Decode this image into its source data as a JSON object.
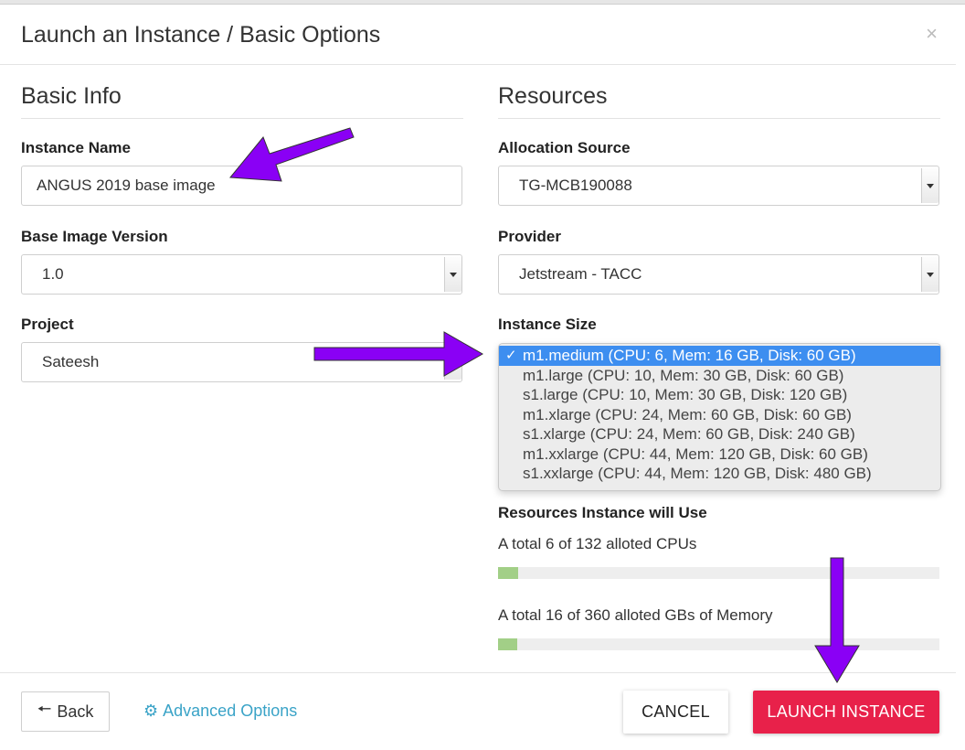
{
  "modal": {
    "title": "Launch an Instance / Basic Options",
    "close_icon": "×"
  },
  "basic_info": {
    "heading": "Basic Info",
    "instance_name": {
      "label": "Instance Name",
      "value": "ANGUS 2019 base image"
    },
    "base_image_version": {
      "label": "Base Image Version",
      "value": "1.0"
    },
    "project": {
      "label": "Project",
      "value": "Sateesh"
    }
  },
  "resources": {
    "heading": "Resources",
    "allocation_source": {
      "label": "Allocation Source",
      "value": "TG-MCB190088"
    },
    "provider": {
      "label": "Provider",
      "value": "Jetstream - TACC"
    },
    "instance_size": {
      "label": "Instance Size",
      "selected_check": "✓",
      "options": [
        "m1.medium (CPU: 6, Mem: 16 GB, Disk: 60 GB)",
        "m1.large (CPU: 10, Mem: 30 GB, Disk: 60 GB)",
        "s1.large (CPU: 10, Mem: 30 GB, Disk: 120 GB)",
        "m1.xlarge (CPU: 24, Mem: 60 GB, Disk: 60 GB)",
        "s1.xlarge (CPU: 24, Mem: 60 GB, Disk: 240 GB)",
        "m1.xxlarge (CPU: 44, Mem: 120 GB, Disk: 60 GB)",
        "s1.xxlarge (CPU: 44, Mem: 120 GB, Disk: 480 GB)"
      ]
    },
    "usage": {
      "heading": "Resources Instance will Use",
      "cpu_text": "A total 6 of 132 alloted CPUs",
      "cpu_fraction": 0.0455,
      "memory_text": "A total 16 of 360 alloted GBs of Memory",
      "memory_fraction": 0.0444
    }
  },
  "footer": {
    "back_label": "Back",
    "back_icon": "arrow-left-icon",
    "advanced_label": "Advanced Options",
    "advanced_icon": "gear-icon",
    "cancel_label": "CANCEL",
    "launch_label": "LAUNCH INSTANCE"
  },
  "colors": {
    "accent_link": "#3aa3c7",
    "launch_button": "#e8214a",
    "selected_option": "#3d8ef0",
    "progress_fill": "#a2cf87",
    "annotation_arrow": "#8a00f5"
  }
}
